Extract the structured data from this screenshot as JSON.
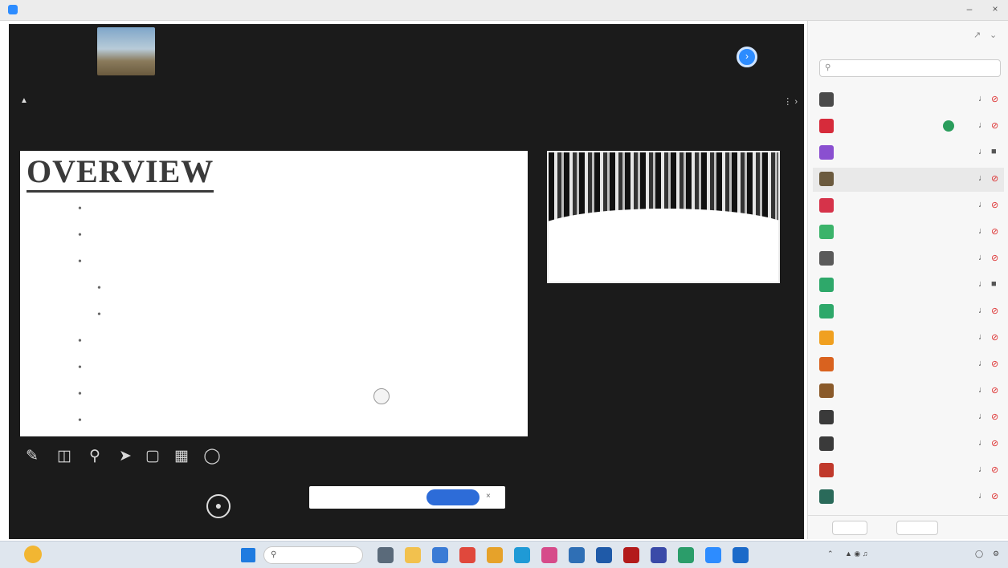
{
  "window": {
    "title": ""
  },
  "strip": {
    "tiles": [
      {
        "name": "",
        "sub": "",
        "has_video": true
      },
      {
        "name": "",
        "sub": ""
      },
      {
        "name": "",
        "sub": ""
      },
      {
        "name": "",
        "sub": ""
      },
      {
        "name": "",
        "sub": ""
      },
      {
        "name": "",
        "sub": ""
      }
    ]
  },
  "share": {
    "presenter": "",
    "meta": [
      "",
      "",
      ""
    ]
  },
  "slide": {
    "title": "OVERVIEW",
    "bullets": [
      {
        "text": "",
        "level": 1
      },
      {
        "text": "",
        "level": 1
      },
      {
        "text": "",
        "level": 1
      },
      {
        "text": "",
        "level": 2
      },
      {
        "text": "",
        "level": 2
      },
      {
        "text": "",
        "level": 1
      },
      {
        "text": "",
        "level": 1
      },
      {
        "text": "",
        "level": 1
      },
      {
        "text": "",
        "level": 1
      }
    ]
  },
  "thumbnail": {
    "caption": ""
  },
  "notice": {
    "text": "",
    "button": ""
  },
  "panel": {
    "title": "",
    "search_placeholder": "",
    "participants": [
      {
        "name": "",
        "color": "#4a4a4a",
        "video_off": true
      },
      {
        "name": "",
        "color": "#d62b3b",
        "video_off": true,
        "speaking": true
      },
      {
        "name": "",
        "color": "#8a4fd0",
        "video_off": false
      },
      {
        "name": "",
        "color": "#6b5a3e",
        "video_off": true,
        "highlight": true
      },
      {
        "name": "",
        "color": "#d6334a",
        "video_off": true
      },
      {
        "name": "",
        "color": "#3bb36a",
        "video_off": true
      },
      {
        "name": "",
        "color": "#5a5a5a",
        "video_off": true
      },
      {
        "name": "",
        "color": "#2ea86a",
        "video_off": false
      },
      {
        "name": "",
        "color": "#2ea86a",
        "video_off": true
      },
      {
        "name": "",
        "color": "#f0a020",
        "video_off": true
      },
      {
        "name": "",
        "color": "#d9621f",
        "video_off": true
      },
      {
        "name": "",
        "color": "#8a5a2a",
        "video_off": true
      },
      {
        "name": "",
        "color": "#3a3a3a",
        "video_off": true
      },
      {
        "name": "",
        "color": "#3a3a3a",
        "video_off": true
      },
      {
        "name": "",
        "color": "#c0392b",
        "video_off": true
      },
      {
        "name": "",
        "color": "#2a6a5a",
        "video_off": true
      }
    ],
    "footer": [
      "",
      ""
    ]
  },
  "taskbar": {
    "weather": "",
    "weather_sub": "",
    "search": "",
    "apps": [
      {
        "name": "task-view-icon",
        "color": "#5a6a7a"
      },
      {
        "name": "file-explorer-icon",
        "color": "#f2c14e"
      },
      {
        "name": "app-icon-1",
        "color": "#3a7bd5"
      },
      {
        "name": "chrome-icon",
        "color": "#e0483c"
      },
      {
        "name": "app-icon-2",
        "color": "#e6a22a"
      },
      {
        "name": "edge-icon",
        "color": "#1f9ad6"
      },
      {
        "name": "app-icon-3",
        "color": "#d64b8a"
      },
      {
        "name": "app-icon-4",
        "color": "#2f6fb5"
      },
      {
        "name": "app-icon-5",
        "color": "#1f5aa8"
      },
      {
        "name": "app-icon-6",
        "color": "#b31b1b"
      },
      {
        "name": "app-icon-7",
        "color": "#3a4aa8"
      },
      {
        "name": "app-icon-8",
        "color": "#2b9d6a"
      },
      {
        "name": "zoom-icon",
        "color": "#2d8cff"
      },
      {
        "name": "app-icon-9",
        "color": "#1b6ac9"
      }
    ],
    "time": "",
    "date": ""
  }
}
